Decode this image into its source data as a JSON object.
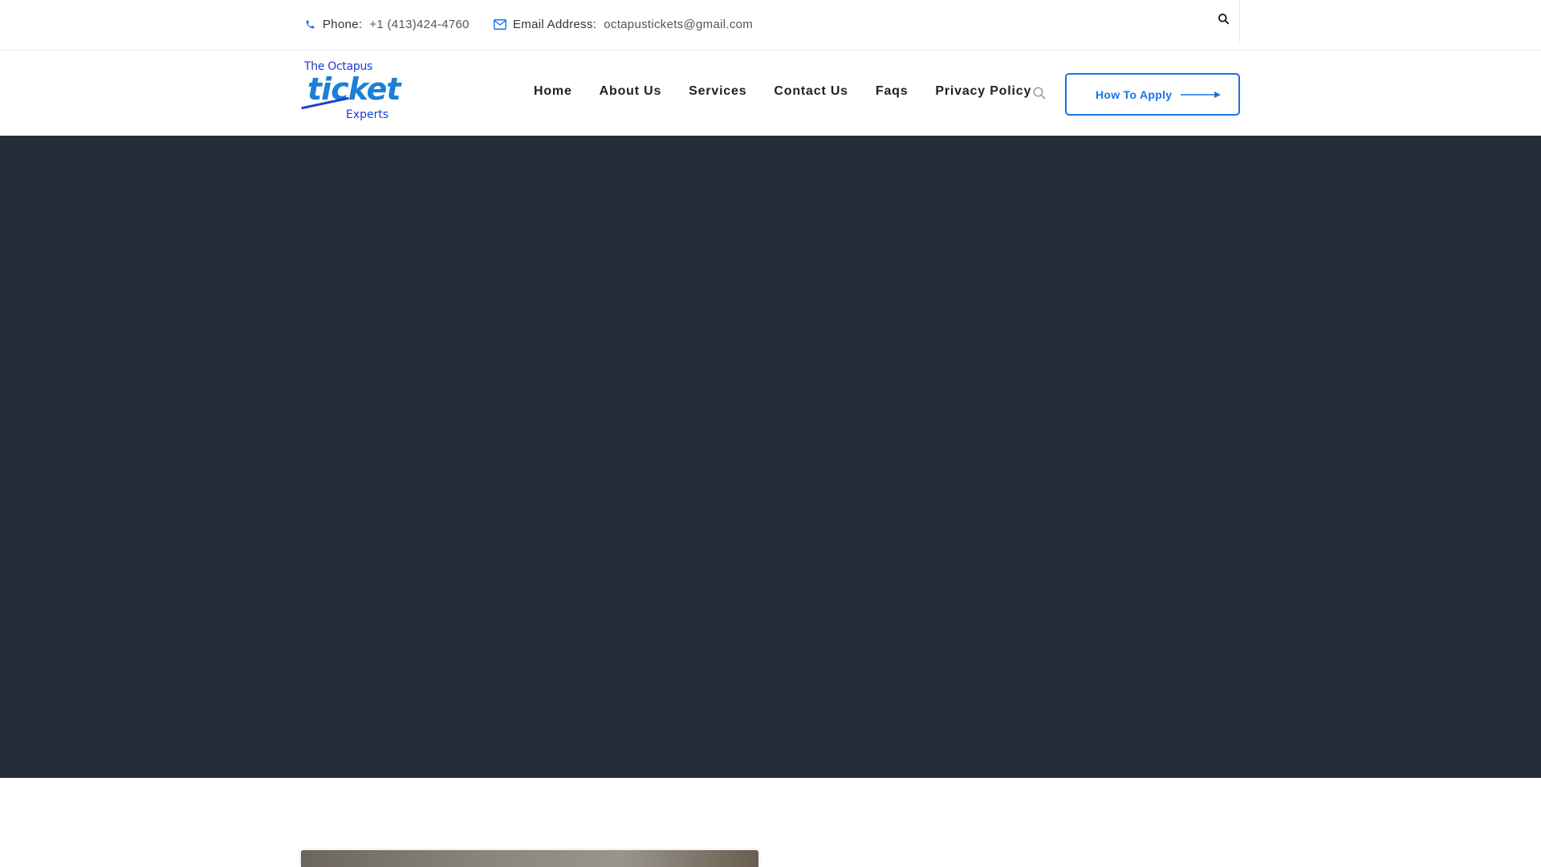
{
  "topbar": {
    "phone_label": "Phone:",
    "phone_value": "+1 (413)424-4760",
    "email_label": "Email Address:",
    "email_value": "octapustickets@gmail.com"
  },
  "logo": {
    "line1": "The Octapus",
    "line2": "ticket",
    "line3": "Experts"
  },
  "nav": {
    "items": [
      "Home",
      "About Us",
      "Services",
      "Contact Us",
      "Faqs",
      "Privacy Policy"
    ]
  },
  "cta": {
    "label": "How To Apply"
  },
  "colors": {
    "accent": "#1a73e8",
    "hero_bg": "#232e39",
    "logo_blue": "#1d7fd6"
  },
  "icons": {
    "phone": "phone-icon",
    "email": "envelope-icon",
    "search": "search-icon",
    "arrow": "arrow-right-icon"
  }
}
